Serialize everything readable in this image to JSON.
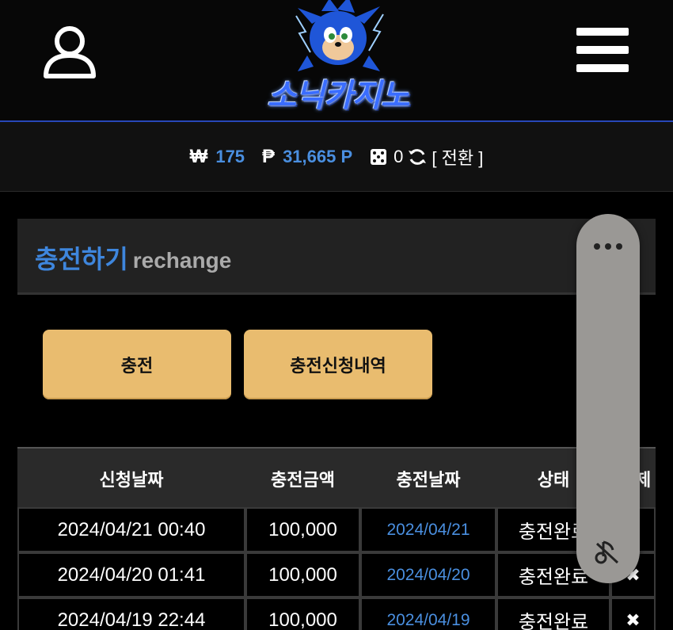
{
  "header": {
    "logo_text": "소닉카지노"
  },
  "balance": {
    "won_symbol": "₩",
    "won_value": "175",
    "point_symbol": "₱",
    "point_value": "31,665 P",
    "dice_value": "0",
    "convert_label": "[ 전환 ]"
  },
  "section": {
    "title": "충전하기",
    "subtitle": "rechange"
  },
  "buttons": {
    "charge_label": "충전",
    "history_label": "충전신청내역"
  },
  "table": {
    "headers": [
      "신청날짜",
      "충전금액",
      "충전날짜",
      "상태",
      "삭제"
    ],
    "header_partial": "제",
    "rows": [
      {
        "request_date": "2024/04/21 00:40",
        "amount": "100,000",
        "charge_date": "2024/04/21",
        "status": "충전완료"
      },
      {
        "request_date": "2024/04/20 01:41",
        "amount": "100,000",
        "charge_date": "2024/04/20",
        "status": "충전완료"
      },
      {
        "request_date": "2024/04/19 22:44",
        "amount": "100,000",
        "charge_date": "2024/04/19",
        "status": "충전완료"
      }
    ]
  },
  "icons": {
    "user": "user-icon",
    "menu": "hamburger-menu-icon",
    "dice": "dice-icon",
    "refresh": "refresh-icon",
    "delete": "close-x-icon",
    "overlay_more": "more-dots-icon",
    "overlay_hide": "hide-icon"
  },
  "colors": {
    "accent_blue": "#3e86dd",
    "button_gold": "#e9bc6f",
    "background": "#000000"
  }
}
